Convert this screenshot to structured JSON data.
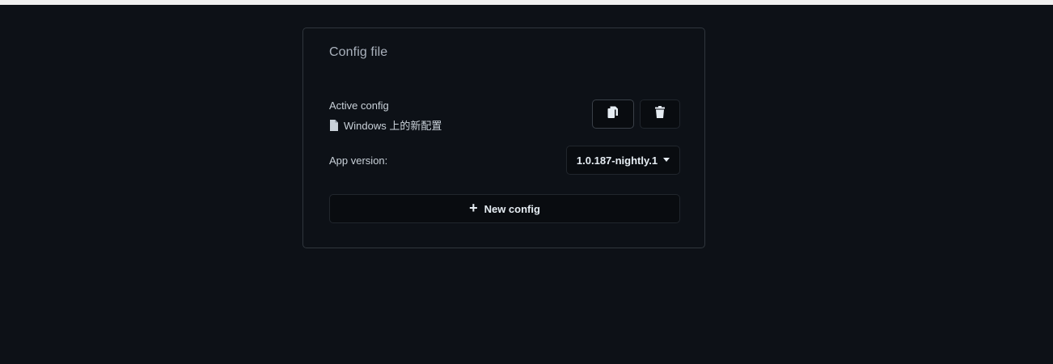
{
  "card": {
    "title": "Config file"
  },
  "active_config": {
    "label": "Active config",
    "name": "Windows 上的新配置",
    "icon": "file-icon"
  },
  "actions": {
    "copy_icon": "copy-icon",
    "delete_icon": "trash-icon"
  },
  "app_version": {
    "label": "App version:",
    "selected": "1.0.187-nightly.1"
  },
  "new_config": {
    "label": "New config",
    "icon": "plus-icon"
  },
  "colors": {
    "background": "#0d1117",
    "card_border": "#30363d",
    "button_bg": "#090c10",
    "text": "#c9d1d9"
  }
}
